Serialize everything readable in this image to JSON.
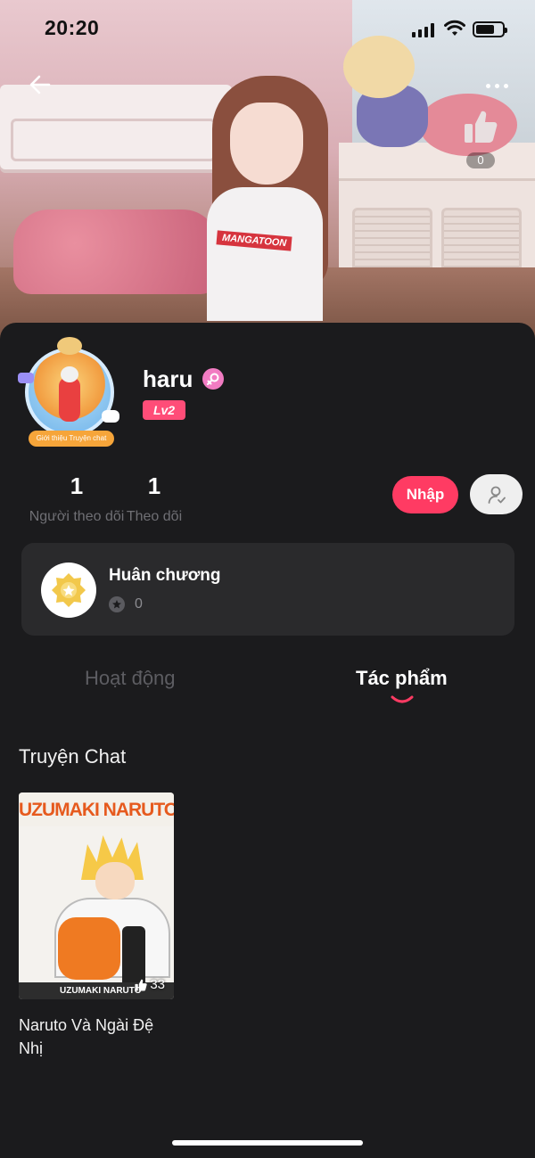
{
  "status_bar": {
    "time": "20:20"
  },
  "cover": {
    "shirt_logo": "MANGATOON",
    "likes": "0"
  },
  "profile": {
    "username": "haru",
    "level": "Lv2",
    "avatar_badge": "Giới thiệu Truyện chat",
    "followers": {
      "count": "1",
      "label": "Người theo dõi"
    },
    "following": {
      "count": "1",
      "label": "Theo dõi"
    },
    "follow_button": "Nhập"
  },
  "medal": {
    "title": "Huân chương",
    "count": "0"
  },
  "tabs": [
    {
      "label": "Hoạt động",
      "active": false
    },
    {
      "label": "Tác phẩm",
      "active": true
    }
  ],
  "works": {
    "section_title": "Truyện Chat",
    "items": [
      {
        "cover_header": "UZUMAKI NARUTO",
        "cover_footer": "UZUMAKI NARUTO",
        "likes": "33",
        "title": "Naruto Và Ngài Đệ Nhị"
      }
    ]
  },
  "colors": {
    "accent": "#ff3b63",
    "level_badge": "#ff4d78",
    "background": "#1b1b1d",
    "card": "#2a2a2c",
    "muted_text": "#6f6f74"
  },
  "icons": [
    "back-arrow-icon",
    "more-icon",
    "thumbs-up-icon",
    "female-icon",
    "user-check-icon",
    "medal-icon",
    "star-icon"
  ]
}
